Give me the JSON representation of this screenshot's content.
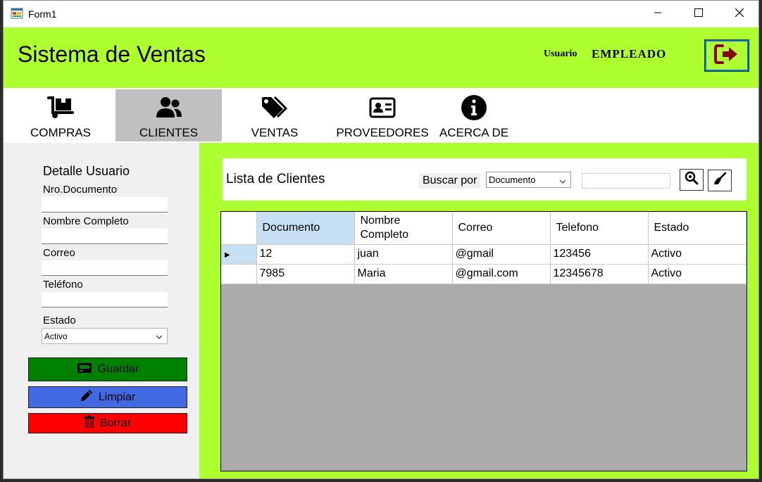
{
  "window": {
    "title": "Form1",
    "controls": [
      "minimize",
      "maximize",
      "close"
    ]
  },
  "header": {
    "app_title": "Sistema de Ventas",
    "user_label": "Usuario",
    "user_name": "EMPLEADO",
    "logout_icon": "sign-out-icon"
  },
  "menu": {
    "items": [
      {
        "label": "COMPRAS",
        "icon": "dolly-icon",
        "active": false
      },
      {
        "label": "CLIENTES",
        "icon": "users-icon",
        "active": true
      },
      {
        "label": "VENTAS",
        "icon": "tags-icon",
        "active": false
      },
      {
        "label": "PROVEEDORES",
        "icon": "address-card-icon",
        "active": false
      },
      {
        "label": "ACERCA DE",
        "icon": "info-icon",
        "active": false
      }
    ]
  },
  "detail": {
    "title": "Detalle Usuario",
    "fields": {
      "documento": {
        "label": "Nro.Documento",
        "value": ""
      },
      "nombre": {
        "label": "Nombre Completo",
        "value": ""
      },
      "correo": {
        "label": "Correo",
        "value": ""
      },
      "telefono": {
        "label": "Teléfono",
        "value": ""
      },
      "estado": {
        "label": "Estado",
        "value": "Activo"
      }
    },
    "buttons": {
      "guardar": "Guardar",
      "limpiar": "Limpiar",
      "borrar": "Borrar"
    }
  },
  "list": {
    "title": "Lista de Clientes",
    "search_label": "Buscar por",
    "search_field": "Documento",
    "search_value": "",
    "columns": [
      "Documento",
      "Nombre Completo",
      "Correo",
      "Telefono",
      "Estado"
    ],
    "rows": [
      [
        "12",
        "juan",
        "@gmail",
        "123456",
        "Activo"
      ],
      [
        "7985",
        "Maria",
        "@gmail.com",
        "12345678",
        "Activo"
      ]
    ],
    "current_row": 0
  },
  "colors": {
    "accent_green": "#adff2f",
    "guardar": "#008000",
    "limpiar": "#4169e1",
    "borrar": "#ff0000",
    "logout_icon": "#8b0000",
    "selected_header": "#c6dff2"
  }
}
